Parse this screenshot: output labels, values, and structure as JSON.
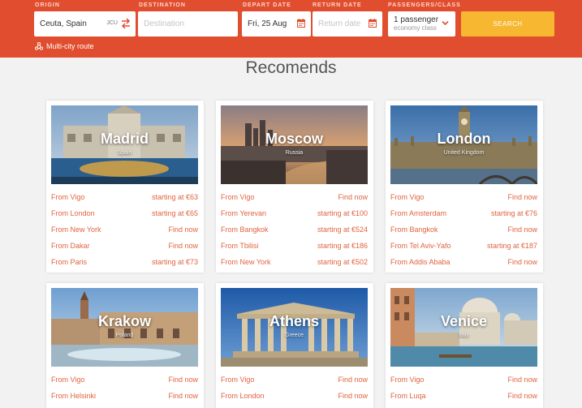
{
  "search": {
    "origin_label": "ORIGIN",
    "origin_value": "Ceuta, Spain",
    "origin_code": "JCU",
    "destination_label": "DESTINATION",
    "destination_placeholder": "Destination",
    "depart_label": "DEPART DATE",
    "depart_value": "Fri, 25 Aug",
    "return_label": "RETURN DATE",
    "return_placeholder": "Return date",
    "pax_label": "PASSENGERS/CLASS",
    "pax_value": "1 passenger",
    "class_value": "economy class",
    "search_button": "SEARCH",
    "multi_city": "Multi-city route"
  },
  "section_title": "Recomends",
  "colors": {
    "header": "#e04e2f",
    "accent": "#f7b731",
    "link": "#e0633f"
  },
  "cards": [
    {
      "city": "Madrid",
      "country": "Spain",
      "routes": [
        {
          "from": "From Vigo",
          "price": "starting at €63"
        },
        {
          "from": "From London",
          "price": "starting at €65"
        },
        {
          "from": "From New York",
          "price": "Find now"
        },
        {
          "from": "From Dakar",
          "price": "Find now"
        },
        {
          "from": "From Paris",
          "price": "starting at €73"
        }
      ]
    },
    {
      "city": "Moscow",
      "country": "Russia",
      "routes": [
        {
          "from": "From Vigo",
          "price": "Find now"
        },
        {
          "from": "From Yerevan",
          "price": "starting at €100"
        },
        {
          "from": "From Bangkok",
          "price": "starting at €524"
        },
        {
          "from": "From Tbilisi",
          "price": "starting at €186"
        },
        {
          "from": "From New York",
          "price": "starting at €502"
        }
      ]
    },
    {
      "city": "London",
      "country": "United Kingdom",
      "routes": [
        {
          "from": "From Vigo",
          "price": "Find now"
        },
        {
          "from": "From Amsterdam",
          "price": "starting at €76"
        },
        {
          "from": "From Bangkok",
          "price": "Find now"
        },
        {
          "from": "From Tel Aviv-Yafo",
          "price": "starting at €187"
        },
        {
          "from": "From Addis Ababa",
          "price": "Find now"
        }
      ]
    },
    {
      "city": "Krakow",
      "country": "Poland",
      "routes": [
        {
          "from": "From Vigo",
          "price": "Find now"
        },
        {
          "from": "From Helsinki",
          "price": "Find now"
        }
      ]
    },
    {
      "city": "Athens",
      "country": "Greece",
      "routes": [
        {
          "from": "From Vigo",
          "price": "Find now"
        },
        {
          "from": "From London",
          "price": "Find now"
        }
      ]
    },
    {
      "city": "Venice",
      "country": "Italy",
      "routes": [
        {
          "from": "From Vigo",
          "price": "Find now"
        },
        {
          "from": "From Luqa",
          "price": "Find now"
        }
      ]
    }
  ]
}
